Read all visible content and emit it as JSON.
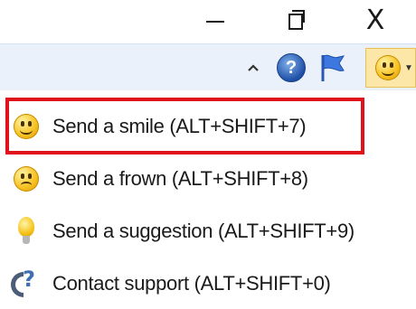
{
  "window": {
    "minimize_glyph": "",
    "close_glyph": "X"
  },
  "ribbon": {
    "collapse_glyph": "^",
    "help_glyph": "?"
  },
  "menu": {
    "items": [
      {
        "label": "Send a smile (ALT+SHIFT+7)",
        "icon": "smile-icon",
        "selected": true
      },
      {
        "label": "Send a frown (ALT+SHIFT+8)",
        "icon": "frown-icon",
        "selected": false
      },
      {
        "label": "Send a suggestion (ALT+SHIFT+9)",
        "icon": "lightbulb-icon",
        "selected": false
      },
      {
        "label": "Contact support (ALT+SHIFT+0)",
        "icon": "support-phone-icon",
        "selected": false
      }
    ]
  },
  "colors": {
    "highlight_border": "#e0121b",
    "ribbon_bg": "#eaf1fa",
    "smile_button_bg": "#fde7a8"
  }
}
